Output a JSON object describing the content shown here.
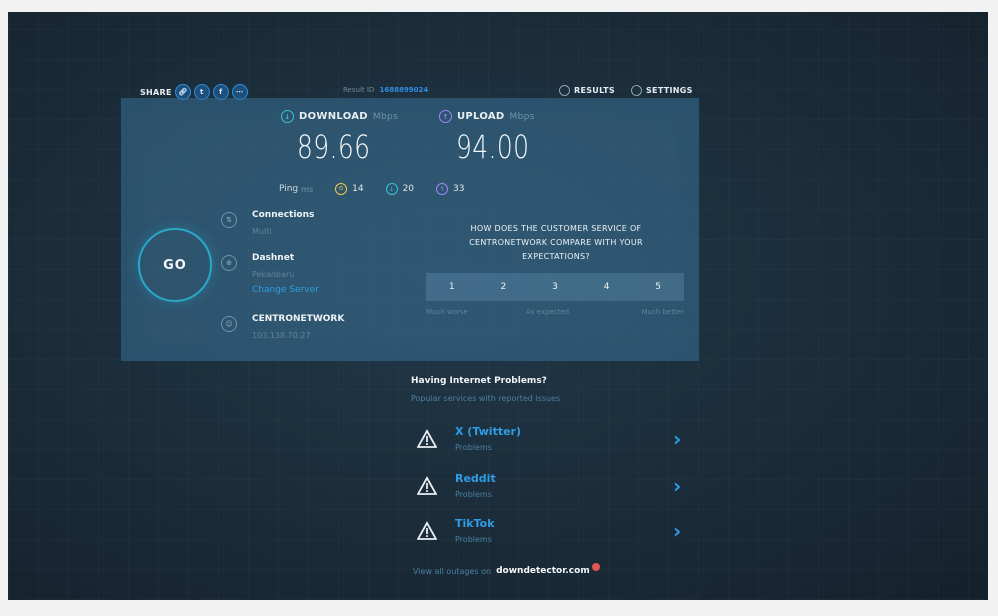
{
  "header": {
    "share_label": "SHARE",
    "share_icons": [
      "link-icon",
      "twitter-icon",
      "facebook-icon",
      "more-icon"
    ],
    "result_id_label": "Result ID",
    "result_id_value": "1688899024",
    "results_label": "RESULTS",
    "settings_label": "SETTINGS"
  },
  "metrics": {
    "download_label": "DOWNLOAD",
    "download_unit": "Mbps",
    "download_value": "89.66",
    "upload_label": "UPLOAD",
    "upload_unit": "Mbps",
    "upload_value": "94.00",
    "ping_label": "Ping",
    "ping_unit": "ms",
    "ping_idle": "14",
    "ping_download": "20",
    "ping_upload": "33"
  },
  "go_label": "GO",
  "connections": {
    "title": "Connections",
    "value": "Multi"
  },
  "isp": {
    "name": "Dashnet",
    "location": "Pekanbaru",
    "change_server": "Change Server"
  },
  "host": {
    "name": "CENTRONETWORK",
    "ip": "103.138.70.27"
  },
  "survey": {
    "question": "HOW DOES THE CUSTOMER SERVICE OF CENTRONETWORK COMPARE WITH YOUR EXPECTATIONS?",
    "ratings": [
      "1",
      "2",
      "3",
      "4",
      "5"
    ],
    "legend_left": "Much worse",
    "legend_mid": "As expected",
    "legend_right": "Much better"
  },
  "downdetector": {
    "title": "Having Internet Problems?",
    "subtitle": "Popular services with reported issues",
    "items": [
      {
        "name": "X (Twitter)",
        "status": "Problems"
      },
      {
        "name": "Reddit",
        "status": "Problems"
      },
      {
        "name": "TikTok",
        "status": "Problems"
      }
    ],
    "footer_prefix": "View all outages on",
    "footer_brand": "downdetector.com"
  },
  "colors": {
    "accent": "#2f9de6",
    "download": "#36c3d6",
    "upload": "#9f86ff",
    "ping_idle": "#f2c94c"
  }
}
